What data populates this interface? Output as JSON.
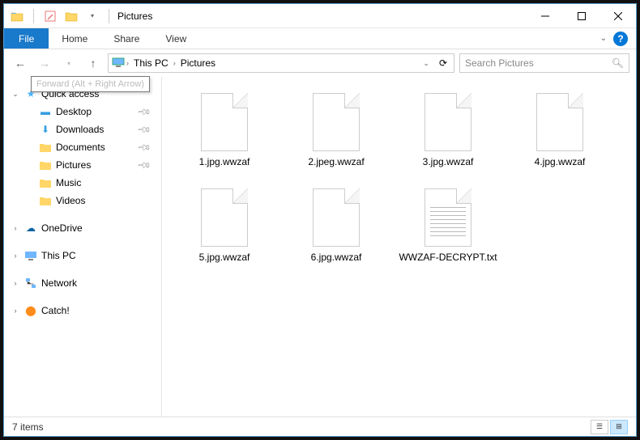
{
  "window": {
    "title": "Pictures"
  },
  "ribbon": {
    "file": "File",
    "home": "Home",
    "share": "Share",
    "view": "View"
  },
  "address": {
    "crumbs": [
      "This PC",
      "Pictures"
    ],
    "tooltip": "Forward (Alt + Right Arrow)"
  },
  "search": {
    "placeholder": "Search Pictures"
  },
  "nav": {
    "quick_access": "Quick access",
    "desktop": "Desktop",
    "downloads": "Downloads",
    "documents": "Documents",
    "pictures": "Pictures",
    "music": "Music",
    "videos": "Videos",
    "onedrive": "OneDrive",
    "this_pc": "This PC",
    "network": "Network",
    "catch": "Catch!"
  },
  "files": [
    {
      "name": "1.jpg.wwzaf",
      "type": "generic"
    },
    {
      "name": "2.jpeg.wwzaf",
      "type": "generic"
    },
    {
      "name": "3.jpg.wwzaf",
      "type": "generic"
    },
    {
      "name": "4.jpg.wwzaf",
      "type": "generic"
    },
    {
      "name": "5.jpg.wwzaf",
      "type": "generic"
    },
    {
      "name": "6.jpg.wwzaf",
      "type": "generic"
    },
    {
      "name": "WWZAF-DECRYPT.txt",
      "type": "txt"
    }
  ],
  "status": {
    "count": "7 items"
  },
  "colors": {
    "accent": "#1979ca",
    "folder": "#ffd667"
  }
}
